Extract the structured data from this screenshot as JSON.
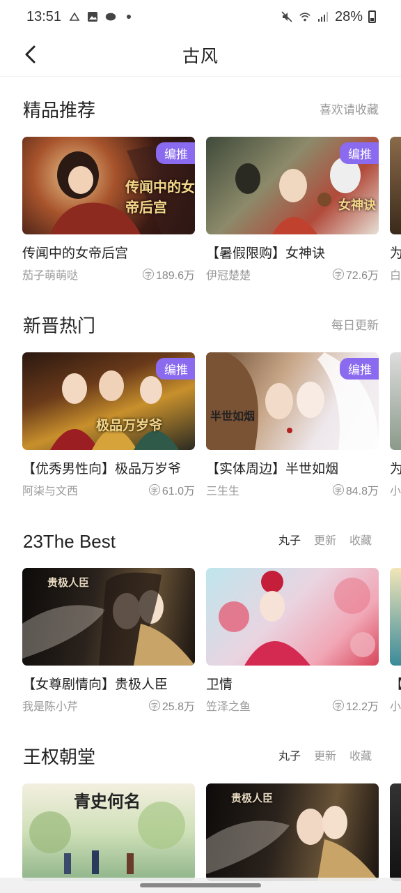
{
  "status_bar": {
    "time": "13:51",
    "battery": "28%"
  },
  "header": {
    "title": "古风"
  },
  "sections": [
    {
      "title": "精品推荐",
      "action": "喜欢请收藏",
      "cards": [
        {
          "title": "传闻中的女帝后宫",
          "author": "茄子萌萌哒",
          "views": "189.6万",
          "badge": "编推",
          "art_text": "传闻中的女帝后宫"
        },
        {
          "title": "【暑假限购】女神诀",
          "author": "伊冠楚楚",
          "views": "72.6万",
          "badge": "编推",
          "art_text": "女神诀"
        },
        {
          "title": "为",
          "author": "白"
        }
      ]
    },
    {
      "title": "新晋热门",
      "action": "每日更新",
      "cards": [
        {
          "title": "【优秀男性向】极品万岁爷",
          "author": "阿柒与文西",
          "views": "61.0万",
          "badge": "编推",
          "art_text": "极品万岁爷"
        },
        {
          "title": "【实体周边】半世如烟",
          "author": "三生生",
          "views": "84.8万",
          "badge": "编推",
          "art_text": "半世如烟"
        },
        {
          "title": "为",
          "author": "小"
        }
      ]
    },
    {
      "title": "23The Best",
      "tabs": [
        "丸子",
        "更新",
        "收藏"
      ],
      "cards": [
        {
          "title": "【女尊剧情向】贵极人臣",
          "author": "我是陈小芹",
          "views": "25.8万",
          "art_text": "贵极人臣"
        },
        {
          "title": "卫情",
          "author": "笠泽之鱼",
          "views": "12.2万"
        },
        {
          "title": "【",
          "author": "小"
        }
      ]
    },
    {
      "title": "王权朝堂",
      "tabs": [
        "丸子",
        "更新",
        "收藏"
      ],
      "cards": [
        {
          "art_text": "青史何名"
        },
        {
          "art_text": "贵极人臣"
        },
        {}
      ]
    }
  ],
  "colors": {
    "badge": "#8a6bf0",
    "muted": "#999999",
    "title": "#222222"
  },
  "icons": [
    "back-arrow-icon",
    "views-coin-icon",
    "wifi-icon",
    "signal-icon",
    "mute-icon",
    "battery-icon"
  ]
}
